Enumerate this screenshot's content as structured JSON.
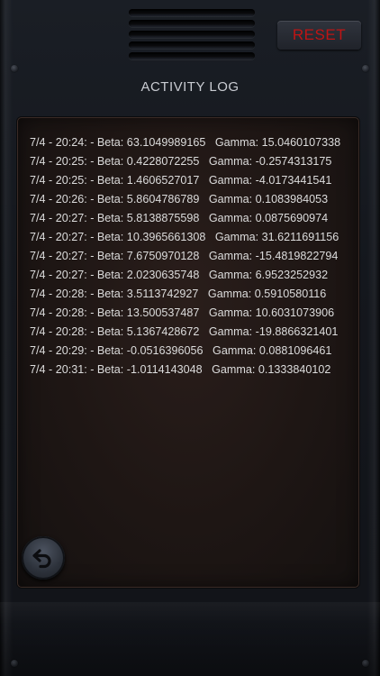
{
  "header": {
    "reset_label": "RESET",
    "title": "ACTIVITY LOG"
  },
  "colors": {
    "reset_text": "#c01414",
    "log_text": "#dcdcdc",
    "panel_bg": "#1e1614"
  },
  "log": {
    "entries": [
      "7/4 - 20:24: - Beta: 63.1049989165   Gamma: 15.0460107338",
      "7/4 - 20:25: - Beta: 0.4228072255   Gamma: -0.2574313175",
      "7/4 - 20:25: - Beta: 1.4606527017   Gamma: -4.0173441541",
      "7/4 - 20:26: - Beta: 5.8604786789   Gamma: 0.1083984053",
      "7/4 - 20:27: - Beta: 5.8138875598   Gamma: 0.0875690974",
      "7/4 - 20:27: - Beta: 10.3965661308   Gamma: 31.6211691156",
      "7/4 - 20:27: - Beta: 7.6750970128   Gamma: -15.4819822794",
      "7/4 - 20:27: - Beta: 2.0230635748   Gamma: 6.9523252932",
      "7/4 - 20:28: - Beta: 3.5113742927   Gamma: 0.5910580116",
      "7/4 - 20:28: - Beta: 13.500537487   Gamma: 10.6031073906",
      "7/4 - 20:28: - Beta: 5.1367428672   Gamma: -19.8866321401",
      "7/4 - 20:29: - Beta: -0.0516396056   Gamma: 0.0881096461",
      "7/4 - 20:31: - Beta: -1.0114143048   Gamma: 0.1333840102"
    ]
  },
  "icons": {
    "back": "back-arrow-icon"
  }
}
